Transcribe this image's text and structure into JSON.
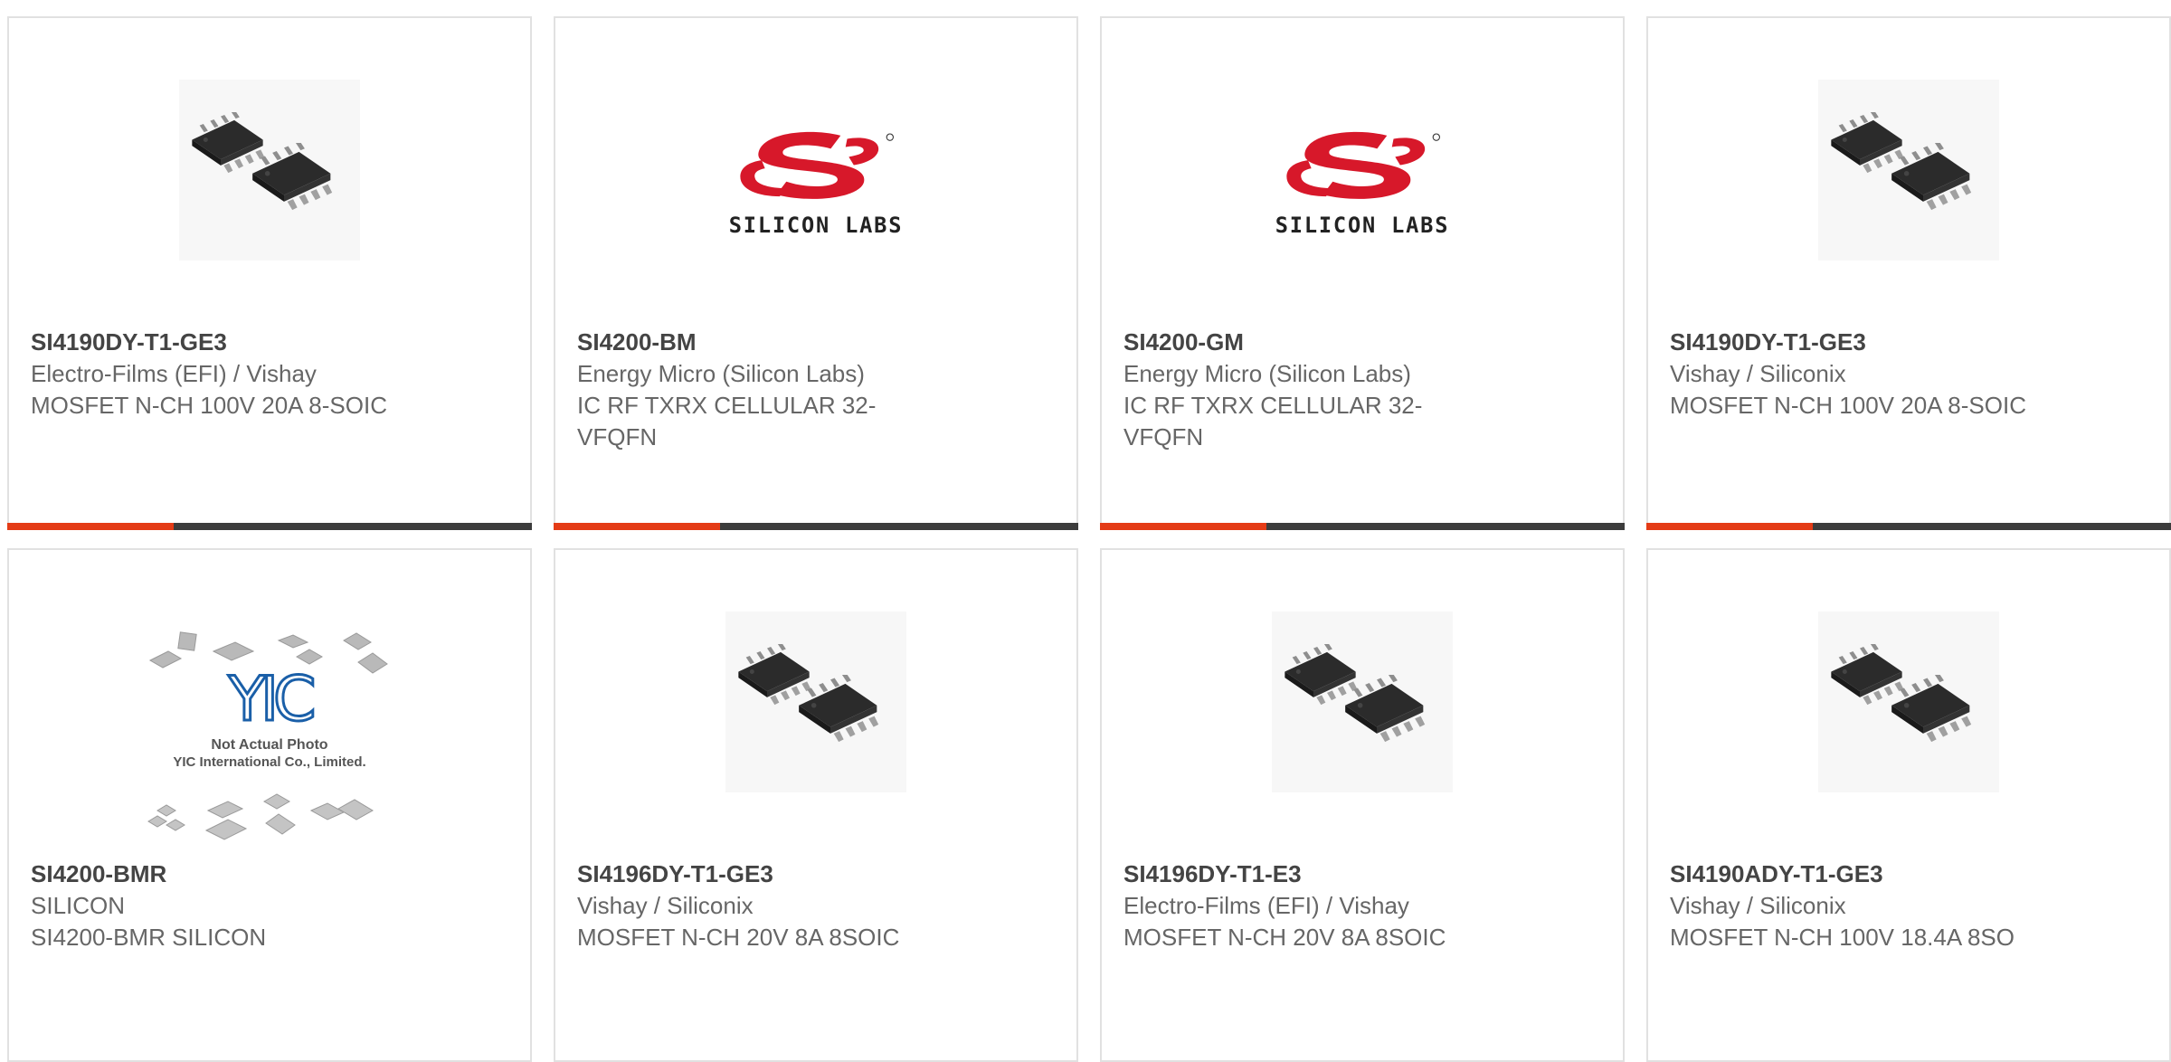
{
  "products": [
    {
      "part": "SI4190DY-T1-GE3",
      "maker": "Electro-Films (EFI) / Vishay",
      "desc": "MOSFET N-CH 100V 20A 8-SOIC",
      "image": "soic-chip-photo"
    },
    {
      "part": "SI4200-BM",
      "maker": "Energy Micro (Silicon Labs)",
      "desc": "IC RF TXRX CELLULAR 32-VFQFN",
      "image": "silicon-labs-logo"
    },
    {
      "part": "SI4200-GM",
      "maker": "Energy Micro (Silicon Labs)",
      "desc": "IC RF TXRX CELLULAR 32-VFQFN",
      "image": "silicon-labs-logo"
    },
    {
      "part": "SI4190DY-T1-GE3",
      "maker": "Vishay / Siliconix",
      "desc": "MOSFET N-CH 100V 20A 8-SOIC",
      "image": "soic-chip-photo"
    },
    {
      "part": "SI4200-BMR",
      "maker": "SILICON",
      "desc": "SI4200-BMR SILICON",
      "image": "yic-placeholder"
    },
    {
      "part": "SI4196DY-T1-GE3",
      "maker": "Vishay / Siliconix",
      "desc": "MOSFET N-CH 20V 8A 8SOIC",
      "image": "soic-chip-photo"
    },
    {
      "part": "SI4196DY-T1-E3",
      "maker": "Electro-Films (EFI) / Vishay",
      "desc": "MOSFET N-CH 20V 8A 8SOIC",
      "image": "soic-chip-photo"
    },
    {
      "part": "SI4190ADY-T1-GE3",
      "maker": "Vishay / Siliconix",
      "desc": "MOSFET N-CH 100V 18.4A 8SO",
      "image": "soic-chip-photo"
    }
  ],
  "logo_text": {
    "silicon_labs": "SILICON LABS",
    "yic_brand": "YIC",
    "yic_line1": "Not Actual Photo",
    "yic_line2": "YIC International Co., Limited."
  },
  "colors": {
    "accent": "#e43b16",
    "bar": "#3c3c3c",
    "card_border": "#e1e1e1",
    "part_text": "#444444",
    "body_text": "#666666",
    "logo_red": "#d7182a",
    "yic_blue": "#1a5fa8"
  }
}
